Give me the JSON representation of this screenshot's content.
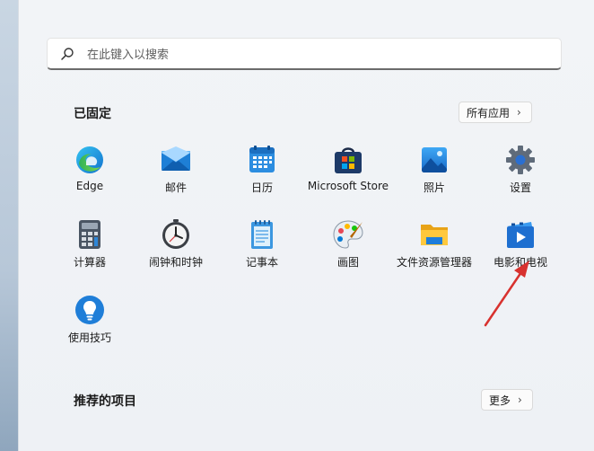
{
  "search": {
    "placeholder": "在此键入以搜索"
  },
  "pinned": {
    "title": "已固定",
    "all_apps_label": "所有应用",
    "apps": [
      {
        "label": "Edge",
        "icon": "edge-icon"
      },
      {
        "label": "邮件",
        "icon": "mail-icon"
      },
      {
        "label": "日历",
        "icon": "calendar-icon"
      },
      {
        "label": "Microsoft Store",
        "icon": "store-icon"
      },
      {
        "label": "照片",
        "icon": "photos-icon"
      },
      {
        "label": "设置",
        "icon": "settings-gear-icon"
      },
      {
        "label": "计算器",
        "icon": "calculator-icon"
      },
      {
        "label": "闹钟和时钟",
        "icon": "alarm-clock-icon"
      },
      {
        "label": "记事本",
        "icon": "notepad-icon"
      },
      {
        "label": "画图",
        "icon": "paint-palette-icon"
      },
      {
        "label": "文件资源管理器",
        "icon": "folder-icon"
      },
      {
        "label": "电影和电视",
        "icon": "movies-tv-icon"
      },
      {
        "label": "使用技巧",
        "icon": "tips-lightbulb-icon"
      }
    ]
  },
  "recommended": {
    "title": "推荐的项目",
    "more_label": "更多"
  },
  "colors": {
    "accent": "#0078d4",
    "annotation_arrow": "#d8322f"
  }
}
